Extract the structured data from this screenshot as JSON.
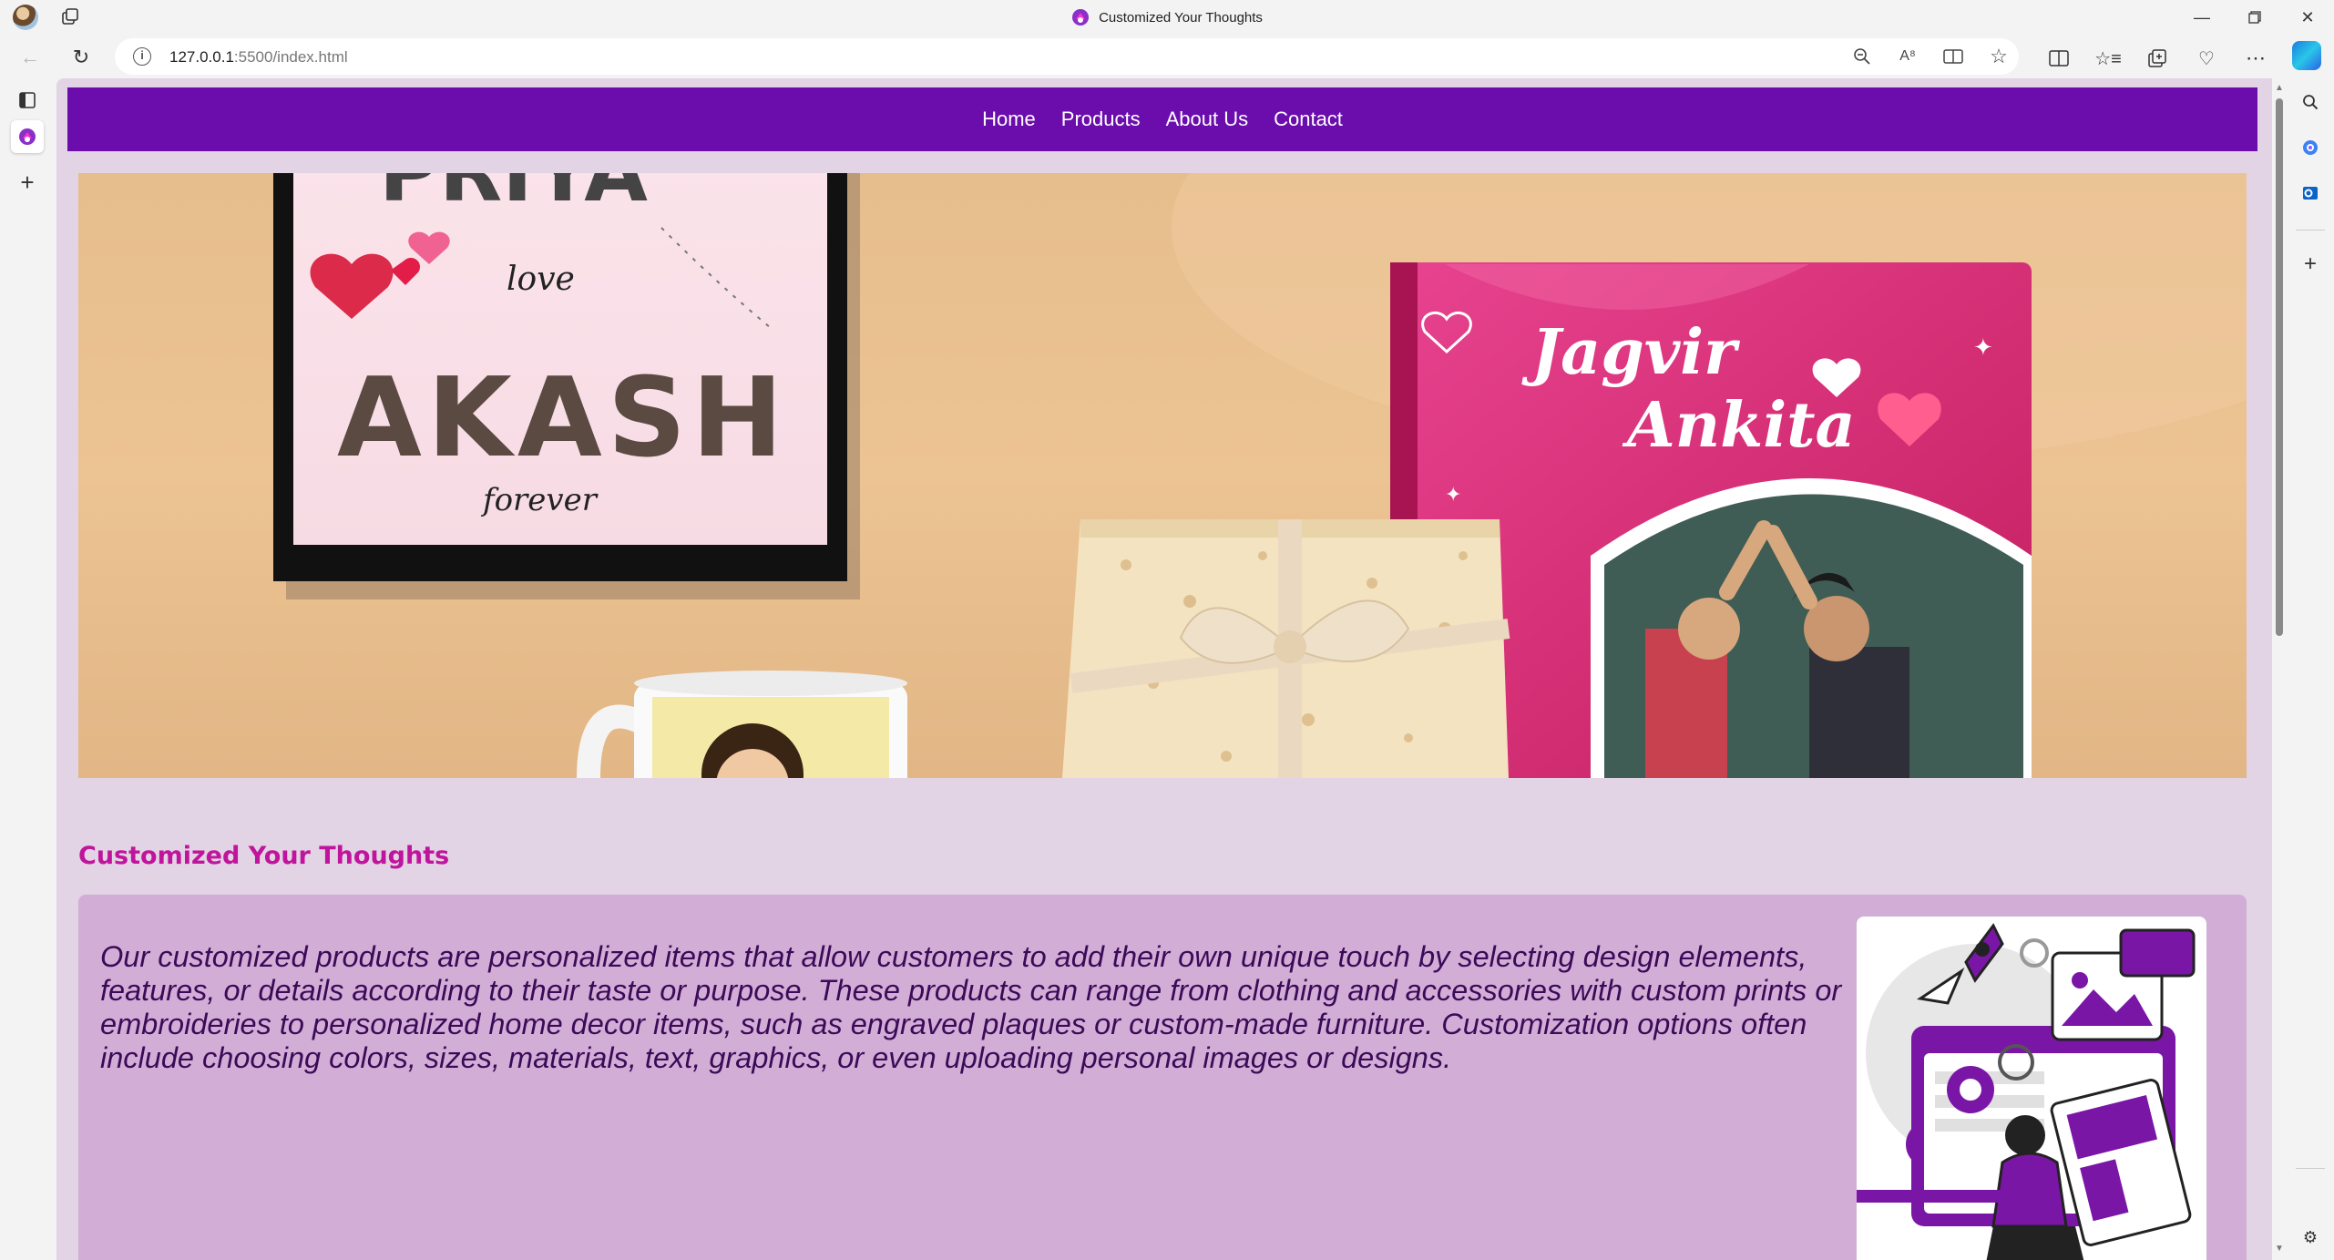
{
  "browser": {
    "tab_title": "Customized Your Thoughts",
    "url_host": "127.0.0.1",
    "url_rest": ":5500/index.html"
  },
  "site": {
    "nav": {
      "links": [
        "Home",
        "Products",
        "About Us",
        "Contact"
      ]
    },
    "hero": {
      "frame_text_top": "PRIYA",
      "frame_text_love": "love",
      "frame_text_name": "AKASH",
      "frame_text_bottom": "forever",
      "book_name_1": "Jagvir",
      "book_name_2": "Ankita"
    },
    "section": {
      "heading": "Customized Your Thoughts",
      "description": "Our customized products are personalized items that allow customers to add their own unique touch by selecting design elements, features, or details according to their taste or purpose. These products can range from clothing and accessories with custom prints or embroideries to personalized home decor items, such as engraved plaques or custom-made furniture. Customization options often include choosing colors, sizes, materials, text, graphics, or even uploading personal images or designs."
    }
  },
  "colors": {
    "nav_bg": "#6b0dad",
    "page_bg": "#e2d3e5",
    "heading": "#c0149c",
    "card_bg": "#d2aed6",
    "text": "#3b0a58"
  },
  "icons": {
    "titlebar": [
      "profile-avatar",
      "workspaces-icon",
      "minimize-icon",
      "restore-icon",
      "close-icon"
    ],
    "toolbar": [
      "back-icon",
      "refresh-icon",
      "site-info-icon",
      "zoom-out-icon",
      "read-aloud-icon",
      "immersive-reader-icon",
      "favorite-star-icon",
      "split-screen-icon",
      "favorites-icon",
      "collections-icon",
      "browser-essentials-icon",
      "more-icon",
      "copilot-icon"
    ],
    "sidebar": [
      "search-icon",
      "copilot-app-icon",
      "outlook-icon",
      "add-icon",
      "settings-icon"
    ]
  }
}
